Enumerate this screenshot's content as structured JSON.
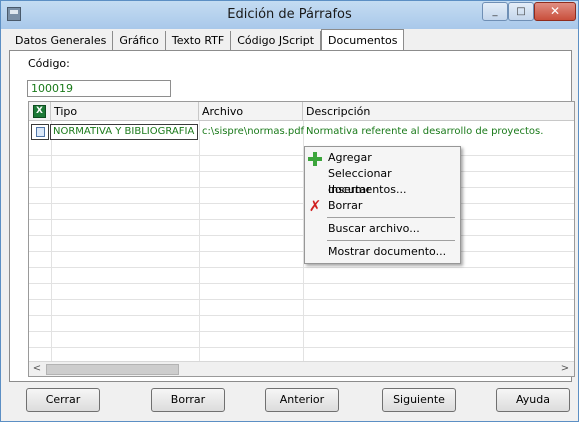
{
  "window": {
    "title": "Edición de Párrafos",
    "min_label": "_",
    "max_label": "□",
    "close_label": "✕"
  },
  "tabs": [
    {
      "label": "Datos Generales"
    },
    {
      "label": "Gráfico"
    },
    {
      "label": "Texto RTF"
    },
    {
      "label": "Código JScript"
    },
    {
      "label": "Documentos",
      "active": true
    }
  ],
  "codigo": {
    "label": "Código:",
    "value": "100019"
  },
  "grid": {
    "columns": [
      "Tipo",
      "Archivo",
      "Descripción"
    ],
    "header_icon": "excel-icon",
    "rows": [
      {
        "tipo": "NORMATIVA Y BIBLIOGRAFIA",
        "archivo": "c:\\sispre\\normas.pdf",
        "descripcion": "Normativa referente al desarrollo de proyectos."
      }
    ],
    "dropdown_glyph": "▼",
    "scroll_left": "<",
    "scroll_right": ">"
  },
  "context_menu": {
    "items": [
      {
        "label": "Agregar",
        "icon": "plus-icon"
      },
      {
        "label": "Seleccionar documentos..."
      },
      {
        "label": "Insertar"
      },
      {
        "label": "Borrar",
        "icon": "x-icon"
      },
      {
        "label": "Buscar archivo..."
      },
      {
        "label": "Mostrar documento..."
      }
    ]
  },
  "buttons": {
    "cerrar": "Cerrar",
    "borrar": "Borrar",
    "anterior": "Anterior",
    "siguiente": "Siguiente",
    "ayuda": "Ayuda"
  },
  "colors": {
    "field_text": "#1a7a1a",
    "titlebar": "#a9c8ea"
  }
}
